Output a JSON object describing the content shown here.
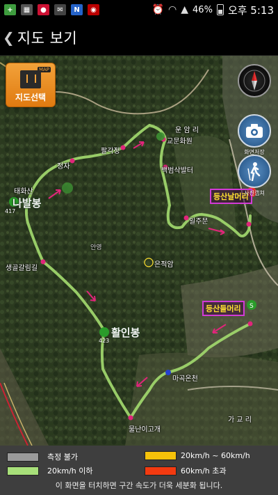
{
  "status_bar": {
    "battery": "46%",
    "time": "오후 5:13"
  },
  "header": {
    "back_icon": "chevron-left",
    "title": "지도 보기"
  },
  "map": {
    "map_select_label": "지도선택",
    "map_select_tag": "MAP",
    "camera_caption": "화면저장",
    "share_caption": "사진캡쳐",
    "route_color": "#a8e07a",
    "places": [
      {
        "id": "unamri",
        "text": "운 암 리"
      },
      {
        "id": "palgakjeong",
        "text": "팔각정"
      },
      {
        "id": "munhwa",
        "text": "교문화원"
      },
      {
        "id": "jeongja",
        "text": "정자"
      },
      {
        "id": "baekbeom",
        "text": "백범삭발터"
      },
      {
        "id": "taehwasan",
        "text": "태화산"
      },
      {
        "id": "nabalbong",
        "text": "나발봉"
      },
      {
        "id": "alt417",
        "text": "417"
      },
      {
        "id": "saenggol",
        "text": "생골갈림길"
      },
      {
        "id": "imjumun",
        "text": "일주문"
      },
      {
        "id": "eunjeokam",
        "text": "은적암"
      },
      {
        "id": "hwarinbong",
        "text": "활인봉"
      },
      {
        "id": "alt423",
        "text": "423"
      },
      {
        "id": "ma_gokonchen",
        "text": "마곡온천"
      },
      {
        "id": "gagyori",
        "text": "가 교 리"
      },
      {
        "id": "mulnani",
        "text": "물난이고개"
      },
      {
        "id": "yangyeong",
        "text": "안영"
      }
    ],
    "trailhead_top": "등산날머리",
    "trailhead_bottom": "등산들머리"
  },
  "legend": {
    "items": [
      {
        "label": "측정 불가",
        "color": "#9a9a9a"
      },
      {
        "label": "20km/h ~ 60km/h",
        "color": "#f6c20a"
      },
      {
        "label": "20km/h 이하",
        "color": "#a8e07a"
      },
      {
        "label": "60km/h 초과",
        "color": "#f33a10"
      }
    ],
    "note": "이 화면을 터치하면 구간 속도가 더욱 세분화 됩니다."
  }
}
